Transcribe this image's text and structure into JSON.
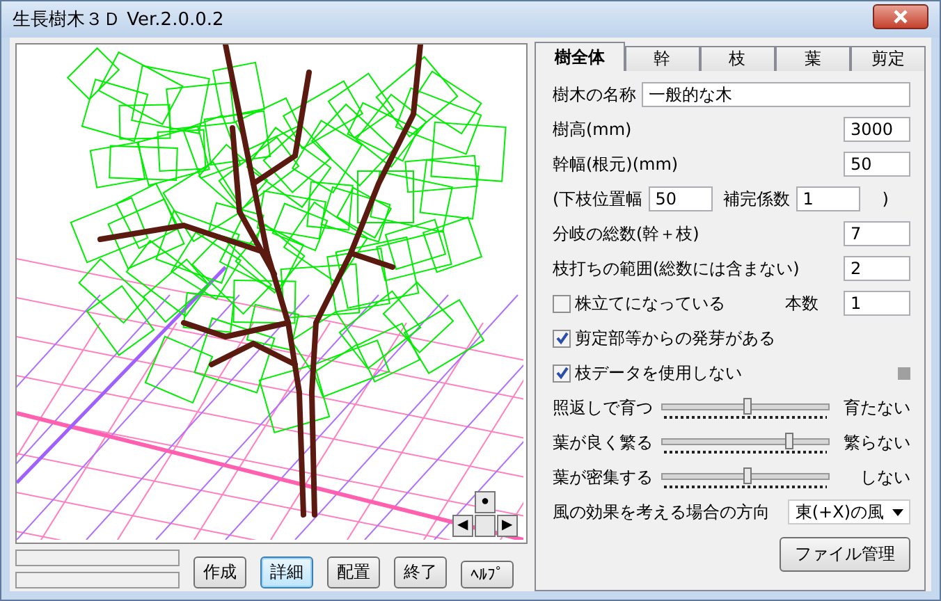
{
  "window": {
    "title": "生長樹木３Ｄ Ver.2.0.0.2"
  },
  "viewport": {
    "nav": [
      "●",
      "◀",
      "▶"
    ]
  },
  "buttons": [
    {
      "label": "作成",
      "selected": false
    },
    {
      "label": "詳細",
      "selected": true
    },
    {
      "label": "配置",
      "selected": false
    },
    {
      "label": "終了",
      "selected": false
    },
    {
      "label": "ﾍﾙﾌﾟ",
      "selected": false
    }
  ],
  "tabs": [
    {
      "label": "樹全体",
      "selected": true
    },
    {
      "label": "幹",
      "selected": false
    },
    {
      "label": "枝",
      "selected": false
    },
    {
      "label": "葉",
      "selected": false
    },
    {
      "label": "剪定",
      "selected": false
    }
  ],
  "rows": [
    {
      "kind": "text",
      "label": "樹木の名称",
      "value": "一般的な木"
    },
    {
      "kind": "number",
      "label": "樹高(mm)",
      "value": "3000"
    },
    {
      "kind": "number",
      "label": "幹幅(根元)(mm)",
      "value": "50"
    },
    {
      "kind": "pair",
      "label": "(下枝位置幅",
      "value": "50",
      "label2": "補完係数",
      "value2": "1",
      "tail": ")"
    },
    {
      "kind": "number",
      "label": "分岐の総数(幹＋枝)",
      "value": "7"
    },
    {
      "kind": "number",
      "label": "枝打ちの範囲(総数には含まない)",
      "value": "2"
    },
    {
      "kind": "checkbox",
      "label": "株立てになっている",
      "checked": false,
      "label2": "本数",
      "value2": "1"
    },
    {
      "kind": "checkbox",
      "label": "剪定部等からの発芽がある",
      "checked": true
    },
    {
      "kind": "checkbox",
      "label": "枝データを使用しない",
      "checked": true,
      "indicator": true
    },
    {
      "kind": "slider",
      "label": "照返しで育つ",
      "end": "育たない",
      "level": 0.5
    },
    {
      "kind": "slider",
      "label": "葉が良く繁る",
      "end": "繁らない",
      "level": 0.75
    },
    {
      "kind": "slider",
      "label": "葉が密集する",
      "end": "しない",
      "level": 0.5
    },
    {
      "kind": "select",
      "label": "風の効果を考える場合の方向",
      "value": "東(+X)の風"
    }
  ],
  "file_button": "ファイル管理"
}
